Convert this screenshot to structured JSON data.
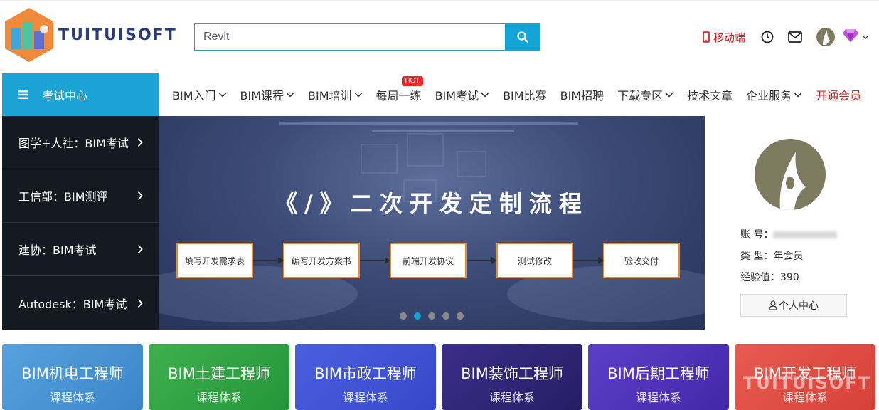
{
  "header": {
    "logo_text": "TUITUISOFT",
    "search": {
      "value": "Revit"
    },
    "mobile_label": "移动端"
  },
  "nav": {
    "exam_center": "考试中心",
    "items": [
      {
        "label": "BIM入门",
        "dropdown": true
      },
      {
        "label": "BIM课程",
        "dropdown": true
      },
      {
        "label": "BIM培训",
        "dropdown": true
      },
      {
        "label": "每周一练",
        "dropdown": false,
        "badge": "HOT"
      },
      {
        "label": "BIM考试",
        "dropdown": true
      },
      {
        "label": "BIM比赛",
        "dropdown": false
      },
      {
        "label": "BIM招聘",
        "dropdown": false
      },
      {
        "label": "下载专区",
        "dropdown": true
      },
      {
        "label": "技术文章",
        "dropdown": false
      },
      {
        "label": "企业服务",
        "dropdown": true
      },
      {
        "label": "开通会员",
        "dropdown": false
      }
    ]
  },
  "side_menu": [
    "图学+人社：BIM考试",
    "工信部：BIM测评",
    "建协：BIM考试",
    "Autodesk：BIM考试"
  ],
  "banner": {
    "title": "《/》二次开发定制流程",
    "steps": [
      "填写开发需求表",
      "编写开发方案书",
      "前端开发协议",
      "测试修改",
      "验收交付"
    ],
    "slides": 5,
    "active_slide": 2
  },
  "user": {
    "account_label": "账 号：",
    "type_label": "类 型：",
    "type_value": "年会员",
    "exp_label": "经验值：",
    "exp_value": "390",
    "center_button": "个人中心"
  },
  "courses": [
    {
      "title": "BIM机电工程师",
      "sub": "课程体系"
    },
    {
      "title": "BIM土建工程师",
      "sub": "课程体系"
    },
    {
      "title": "BIM市政工程师",
      "sub": "课程体系"
    },
    {
      "title": "BIM装饰工程师",
      "sub": "课程体系"
    },
    {
      "title": "BIM后期工程师",
      "sub": "课程体系"
    },
    {
      "title": "BIM开发工程师",
      "sub": "课程体系"
    }
  ],
  "watermark": "TUITUISOFT",
  "colors": {
    "accent": "#11a4d4",
    "nav_red": "#e02020",
    "step_border": "#f08a24",
    "side_bg": "#151a22"
  }
}
